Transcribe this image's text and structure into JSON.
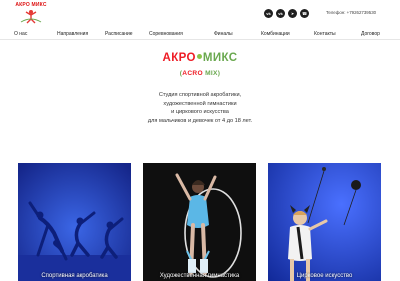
{
  "header": {
    "logo_text": "АКРО МИКС",
    "phone": "Телефон: +79262739530",
    "socials": [
      {
        "icon": "vk-icon",
        "glyph": "vk"
      },
      {
        "icon": "vk-video-icon",
        "glyph": "vk"
      },
      {
        "icon": "telegram-icon",
        "glyph": "➤"
      },
      {
        "icon": "whatsapp-icon",
        "glyph": "☎"
      }
    ]
  },
  "nav": {
    "items": [
      "О нас",
      "Направления",
      "Расписание",
      "Соревнования",
      "Финалы",
      "Комбинации",
      "Контакты",
      "Договор"
    ]
  },
  "brand": {
    "title_part1": "АКРО",
    "title_part2": "МИКС",
    "subtitle_open": "(",
    "subtitle_part1": "ACRO",
    "subtitle_part2": "MIX",
    "subtitle_close": ")"
  },
  "description": {
    "line1": "Студия спортивной акробатики,",
    "line2": "художественной гимнастики",
    "line3": "и циркового искусства",
    "line4": "для мальчиков и девочек от 4 до 18 лет."
  },
  "cards": [
    {
      "label": "Спортивная акробатика"
    },
    {
      "label": "Художественная гимнастика"
    },
    {
      "label": "Цирковое искусство"
    }
  ],
  "colors": {
    "accent_red": "#ee1c25",
    "accent_green": "#6aa84f",
    "blue_stage": "#1c3a9e",
    "dark_stage": "#111111"
  }
}
